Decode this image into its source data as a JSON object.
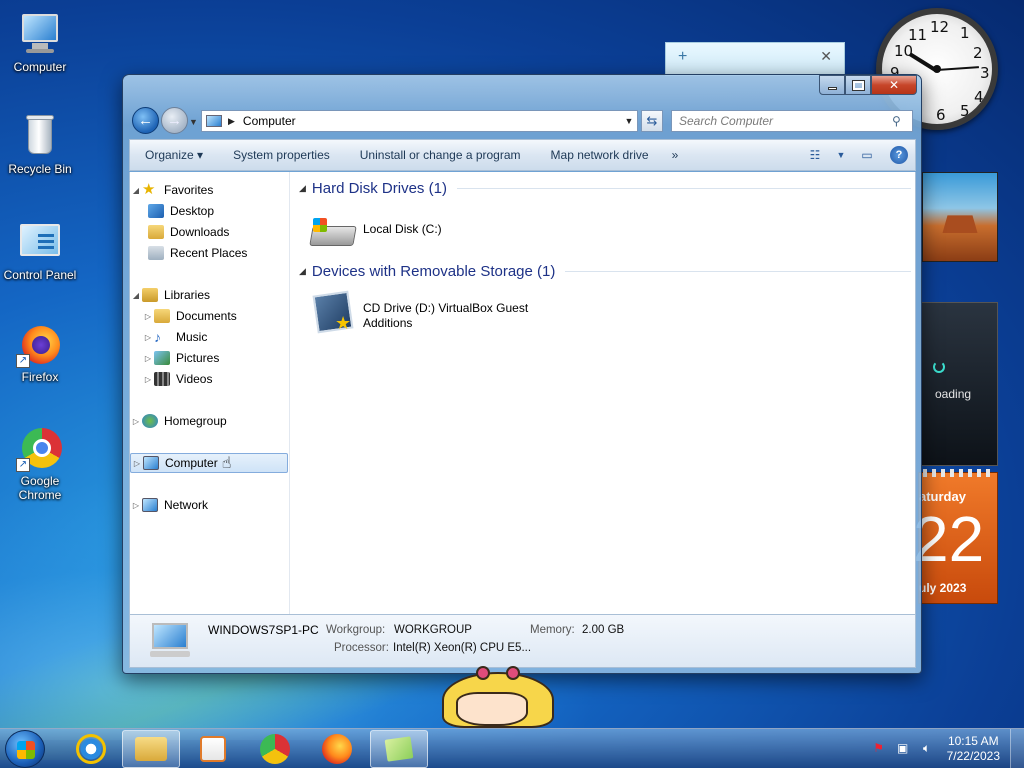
{
  "desktop": {
    "icons": [
      {
        "label": "Computer"
      },
      {
        "label": "Recycle Bin"
      },
      {
        "label": "Control Panel"
      },
      {
        "label": "Firefox"
      },
      {
        "label": "Google Chrome"
      }
    ]
  },
  "gadgets": {
    "media_status": "oading",
    "calendar": {
      "day": "aturday",
      "date": "22",
      "month": "uly 2023"
    },
    "clock_numbers": [
      "12",
      "1",
      "2",
      "3",
      "4",
      "5",
      "6",
      "9",
      "10",
      "11"
    ]
  },
  "window": {
    "address": {
      "location": "Computer"
    },
    "search": {
      "placeholder": "Search Computer"
    },
    "toolbar": {
      "organize": "Organize",
      "system_properties": "System properties",
      "uninstall": "Uninstall or change a program",
      "map_drive": "Map network drive",
      "more": "»"
    },
    "nav": {
      "favorites": "Favorites",
      "desktop": "Desktop",
      "downloads": "Downloads",
      "recent": "Recent Places",
      "libraries": "Libraries",
      "documents": "Documents",
      "music": "Music",
      "pictures": "Pictures",
      "videos": "Videos",
      "homegroup": "Homegroup",
      "computer": "Computer",
      "network": "Network"
    },
    "groups": {
      "hdd": {
        "title": "Hard Disk Drives (1)",
        "items": [
          {
            "label": "Local Disk (C:)"
          }
        ]
      },
      "removable": {
        "title": "Devices with Removable Storage (1)",
        "items": [
          {
            "label": "CD Drive (D:) VirtualBox Guest Additions"
          }
        ]
      }
    },
    "details": {
      "pc_name": "WINDOWS7SP1-PC",
      "workgroup_label": "Workgroup:",
      "workgroup_value": "WORKGROUP",
      "memory_label": "Memory:",
      "memory_value": "2.00 GB",
      "processor_label": "Processor:",
      "processor_value": "Intel(R) Xeon(R) CPU E5..."
    }
  },
  "taskbar": {
    "time": "10:15 AM",
    "date": "7/22/2023"
  },
  "colors": {
    "accent": "#1e3287",
    "selection": "#cfe3f7",
    "close_button": "#c7462a"
  }
}
